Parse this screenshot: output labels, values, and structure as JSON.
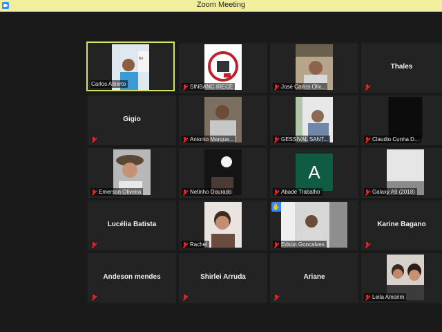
{
  "window": {
    "title": "Zoom Meeting"
  },
  "participants": [
    {
      "name": "Carlos Alberto",
      "label": "Carlos Alberto",
      "muted": false,
      "video": true
    },
    {
      "name": "SINBANC IRECÊ",
      "label": "SINBANC IRECÊ",
      "muted": true,
      "video": true
    },
    {
      "name": "José Carlos Oliv...",
      "label": "José Carlos Oliv...",
      "muted": true,
      "video": true
    },
    {
      "name": "Thales",
      "label": "",
      "muted": true,
      "video": false
    },
    {
      "name": "Gigio",
      "label": "",
      "muted": true,
      "video": false
    },
    {
      "name": "Antonio Marque...",
      "label": "Antonio Marque...",
      "muted": true,
      "video": true
    },
    {
      "name": "GESSIVAL SANT...",
      "label": "GESSIVAL SANT...",
      "muted": true,
      "video": true
    },
    {
      "name": "Claudio Cunha D...",
      "label": "Claudio Cunha D...",
      "muted": true,
      "video": true
    },
    {
      "name": "Emerson Oliveira",
      "label": "Emerson Oliveira",
      "muted": true,
      "video": true
    },
    {
      "name": "Netinho Dourado",
      "label": "Netinho Dourado",
      "muted": true,
      "video": true
    },
    {
      "name": "Abade Trabalho",
      "label": "Abade Trabalho",
      "muted": true,
      "video": true,
      "avatar_letter": "A"
    },
    {
      "name": "Galaxy A9 (2018)",
      "label": "Galaxy A9 (2018)",
      "muted": true,
      "video": true
    },
    {
      "name": "Lucélia Batista",
      "label": "",
      "muted": true,
      "video": false
    },
    {
      "name": "Rachel",
      "label": "Rachel",
      "muted": true,
      "video": true
    },
    {
      "name": "Edson Goncalves",
      "label": "Edson Goncalves",
      "muted": true,
      "video": true,
      "hand_raised": true
    },
    {
      "name": "Karine Bagano",
      "label": "",
      "muted": true,
      "video": false
    },
    {
      "name": "Andeson mendes",
      "label": "",
      "muted": true,
      "video": false
    },
    {
      "name": "Shirlei Arruda",
      "label": "",
      "muted": true,
      "video": false
    },
    {
      "name": "Ariane",
      "label": "",
      "muted": true,
      "video": false
    },
    {
      "name": "Leila Amorim",
      "label": "Leila Amorim",
      "muted": true,
      "video": true
    }
  ],
  "colors": {
    "titlebar": "#f2ef9c",
    "active_border": "#d8e26b",
    "tile_bg": "#232323",
    "mute_icon": "#e02828",
    "avatar_green": "#0f5b44"
  }
}
